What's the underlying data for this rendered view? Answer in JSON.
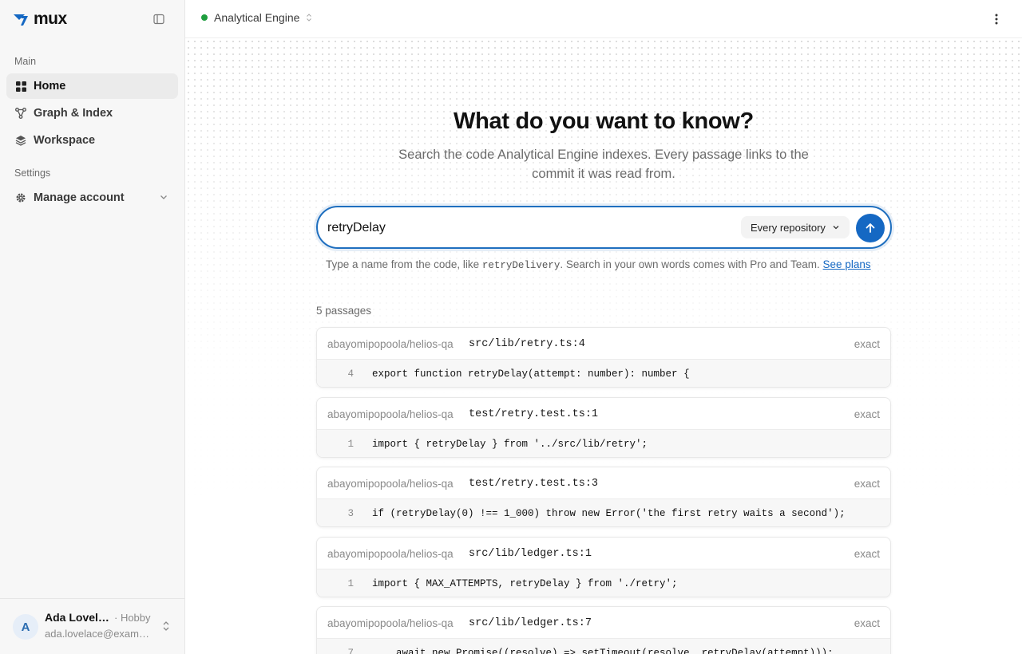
{
  "brand": {
    "name": "mux"
  },
  "sidebar": {
    "main_label": "Main",
    "items": [
      {
        "label": "Home",
        "icon": "grid-icon"
      },
      {
        "label": "Graph & Index",
        "icon": "graph-icon"
      },
      {
        "label": "Workspace",
        "icon": "layers-icon"
      }
    ],
    "settings_label": "Settings",
    "settings_items": [
      {
        "label": "Manage account",
        "icon": "gear-icon"
      }
    ]
  },
  "user": {
    "initial": "A",
    "name": "Ada Lovelace",
    "plan": "· Hobby",
    "email": "ada.lovelace@example.com"
  },
  "topbar": {
    "project": "Analytical Engine"
  },
  "hero": {
    "title": "What do you want to know?",
    "subtitle": "Search the code Analytical Engine indexes. Every passage links to the commit it was read from."
  },
  "search": {
    "value": "retryDelay",
    "scope": "Every repository"
  },
  "hint": {
    "prefix": "Type a name from the code, like ",
    "example": "retryDelivery",
    "middle": ". Search in your own words comes with Pro and Team. ",
    "link": "See plans"
  },
  "results": {
    "count_label": "5 passages",
    "items": [
      {
        "repo": "abayomipopoola/helios-qa",
        "path": "src/lib/retry.ts:4",
        "match": "exact",
        "line": "4",
        "code": "export function retryDelay(attempt: number): number {"
      },
      {
        "repo": "abayomipopoola/helios-qa",
        "path": "test/retry.test.ts:1",
        "match": "exact",
        "line": "1",
        "code": "import { retryDelay } from '../src/lib/retry';"
      },
      {
        "repo": "abayomipopoola/helios-qa",
        "path": "test/retry.test.ts:3",
        "match": "exact",
        "line": "3",
        "code": "if (retryDelay(0) !== 1_000) throw new Error('the first retry waits a second');"
      },
      {
        "repo": "abayomipopoola/helios-qa",
        "path": "src/lib/ledger.ts:1",
        "match": "exact",
        "line": "1",
        "code": "import { MAX_ATTEMPTS, retryDelay } from './retry';"
      },
      {
        "repo": "abayomipopoola/helios-qa",
        "path": "src/lib/ledger.ts:7",
        "match": "exact",
        "line": "7",
        "code": "    await new Promise((resolve) => setTimeout(resolve, retryDelay(attempt)));"
      }
    ]
  }
}
